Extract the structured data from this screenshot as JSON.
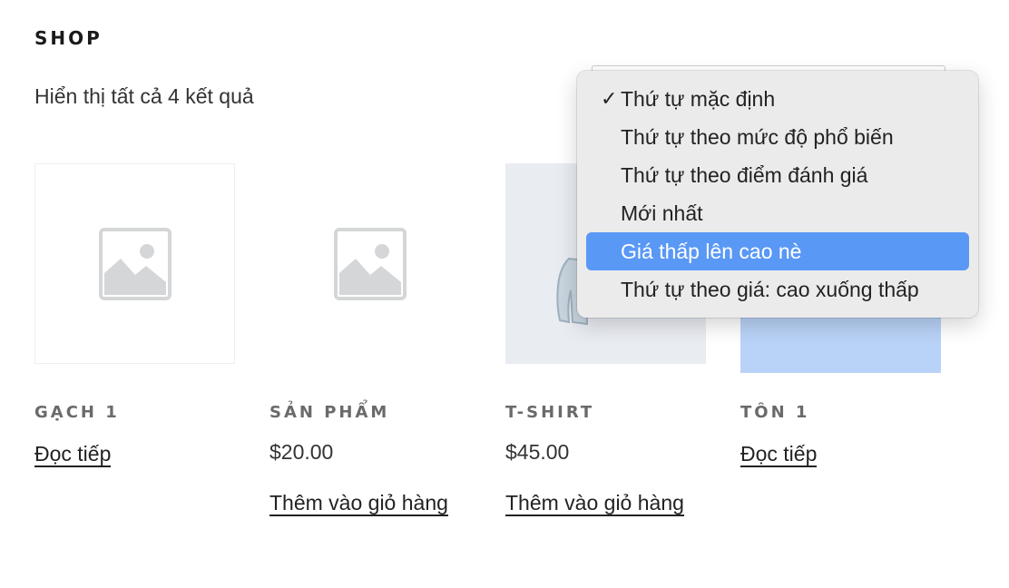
{
  "shop": {
    "title": "SHOP",
    "result_count": "Hiển thị tất cả 4 kết quả"
  },
  "sort": {
    "options": [
      {
        "label": "Thứ tự mặc định",
        "checked": true
      },
      {
        "label": "Thứ tự theo mức độ phổ biến"
      },
      {
        "label": "Thứ tự theo điểm đánh giá"
      },
      {
        "label": "Mới nhất"
      },
      {
        "label": "Giá thấp lên cao nè",
        "highlighted": true
      },
      {
        "label": "Thứ tự theo giá: cao xuống thấp"
      }
    ],
    "check_glyph": "✓"
  },
  "products": [
    {
      "name": "GẠCH 1",
      "price": "",
      "action": "Đọc tiếp",
      "image": "placeholder-icon"
    },
    {
      "name": "SẢN PHẨM",
      "price": "$20.00",
      "action": "Thêm vào giỏ hàng",
      "image": "placeholder-icon"
    },
    {
      "name": "T-SHIRT",
      "price": "$45.00",
      "action": "Thêm vào giỏ hàng",
      "image": "tshirt-image"
    },
    {
      "name": "TÔN 1",
      "price": "",
      "action": "Đọc tiếp",
      "image": "product-image"
    }
  ],
  "colors": {
    "highlight": "#5a98f5",
    "menu_bg": "#ecebeb",
    "selected_image_bg": "#b9d3f8"
  }
}
